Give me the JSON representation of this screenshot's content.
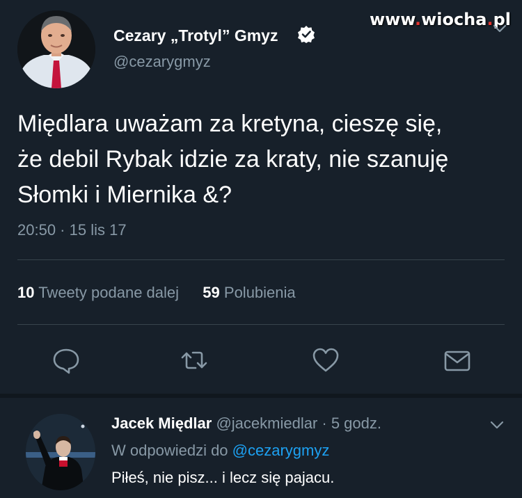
{
  "watermark": {
    "prefix": "www",
    "dot1": ".",
    "middle": "wiocha",
    "dot2": ".",
    "suffix": "pl"
  },
  "tweet": {
    "author_name": "Cezary „Trotyl” Gmyz",
    "author_handle": "@cezarygmyz",
    "verified_icon": "verified-badge-icon",
    "text_lines": [
      "Międlara uważam za kretyna, cieszę się,",
      "że debil Rybak idzie za kraty, nie szanuję",
      "Słomki i Miernika &?"
    ],
    "time": "20:50",
    "date_sep": " · ",
    "date": "15 lis 17",
    "retweets_count": "10",
    "retweets_label": "Tweety podane dalej",
    "likes_count": "59",
    "likes_label": "Polubienia",
    "actions": [
      "reply-icon",
      "retweet-icon",
      "like-icon",
      "message-icon"
    ]
  },
  "reply": {
    "author_name": "Jacek Międlar",
    "author_handle": "@jacekmiedlar",
    "time_sep": " · ",
    "time": "5 godz.",
    "context_prefix": "W odpowiedzi do ",
    "context_mention": "@cezarygmyz",
    "text": "Piłeś, nie pisz... i lecz się pajacu."
  },
  "colors": {
    "background": "#17202a",
    "text_secondary": "#8899a6",
    "accent": "#1da1f2",
    "divider": "#38444d"
  }
}
